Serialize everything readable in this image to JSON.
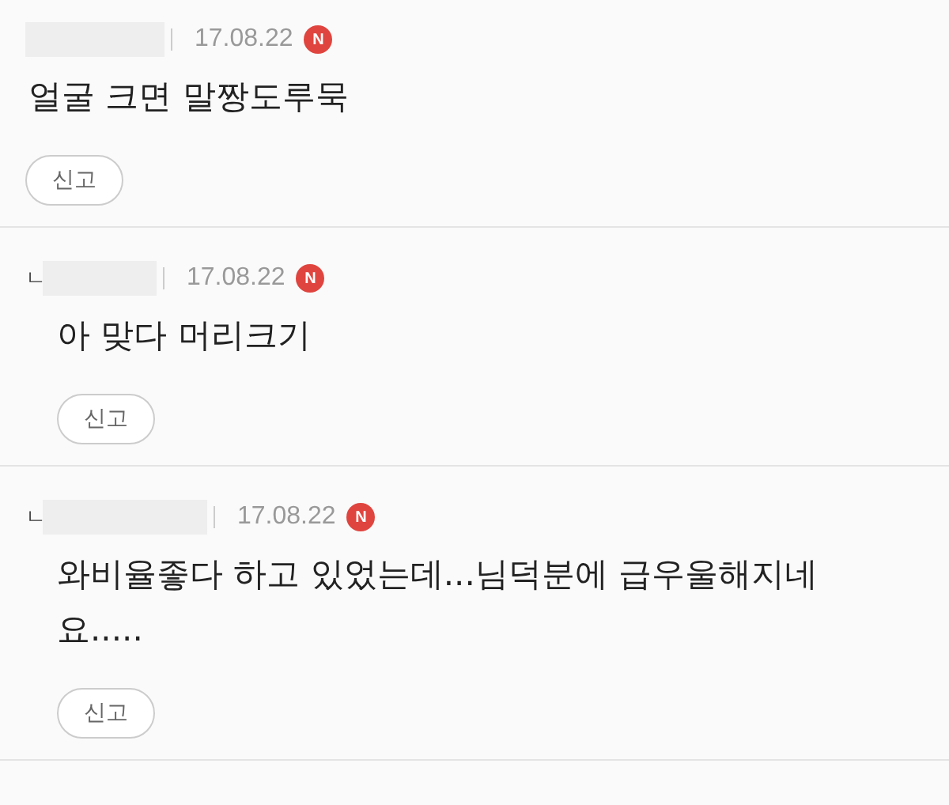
{
  "comments": [
    {
      "kind": "comment",
      "date": "17.08.22",
      "badge": "N",
      "text": "얼굴 크면 말짱도루묵",
      "report": "신고"
    },
    {
      "kind": "reply",
      "reply_mark": "ㄴ",
      "date": "17.08.22",
      "badge": "N",
      "text": "아 맞다 머리크기",
      "report": "신고"
    },
    {
      "kind": "reply",
      "reply_mark": "ㄴ",
      "date": "17.08.22",
      "badge": "N",
      "text": "와비율좋다 하고 있었는데...님덕분에 급우울해지네요.....",
      "report": "신고"
    }
  ]
}
